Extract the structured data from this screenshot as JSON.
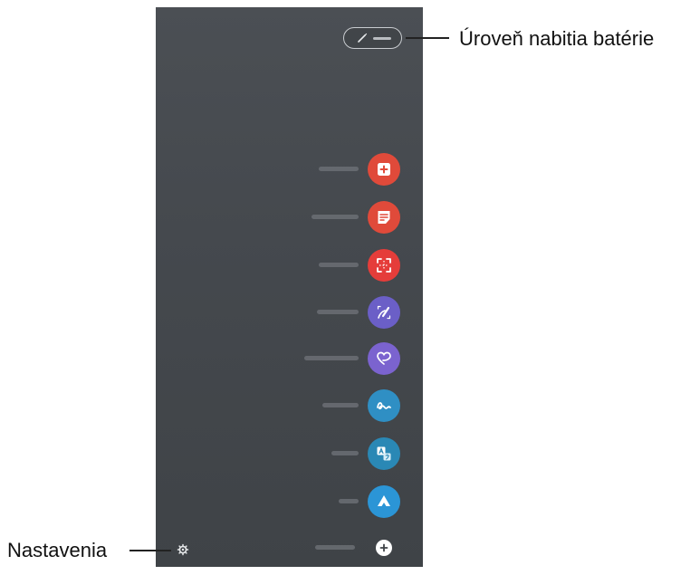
{
  "annotations": {
    "battery_label": "Úroveň nabitia batérie",
    "settings_label": "Nastavenia"
  },
  "menu": {
    "items": [
      {
        "id": "create-note",
        "color": "#e04a3a",
        "icon": "note-plus-icon"
      },
      {
        "id": "view-notes",
        "color": "#e04a3a",
        "icon": "notes-list-icon"
      },
      {
        "id": "smart-select",
        "color": "#e53d3a",
        "icon": "smart-select-icon"
      },
      {
        "id": "screen-write",
        "color": "#6b5fc7",
        "icon": "pen-on-screen-icon"
      },
      {
        "id": "live-messages",
        "color": "#7b63cf",
        "icon": "heart-message-icon"
      },
      {
        "id": "ar-doodle",
        "color": "#2f8fc4",
        "icon": "squiggle-icon"
      },
      {
        "id": "translate",
        "color": "#2a88b5",
        "icon": "translate-icon"
      },
      {
        "id": "bixby-vision",
        "color": "#2b95d6",
        "icon": "vision-icon"
      },
      {
        "id": "add-shortcut",
        "color": "#ffffff",
        "icon": "plus-icon"
      }
    ]
  }
}
